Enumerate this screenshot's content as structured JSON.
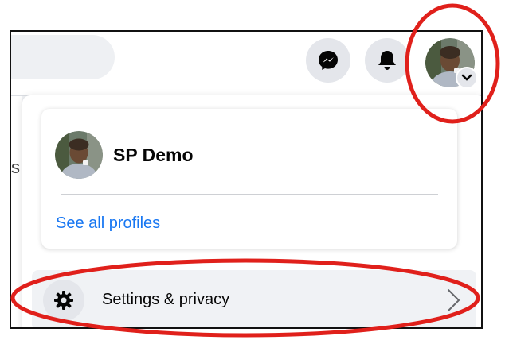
{
  "header": {
    "messenger_icon": "messenger-icon",
    "notifications_icon": "bell-icon",
    "account_icon": "avatar-with-chevron"
  },
  "left_partial_text": "s",
  "profile_menu": {
    "profile_name": "SP Demo",
    "see_all_profiles": "See all profiles"
  },
  "settings_row": {
    "label": "Settings & privacy",
    "icon": "gear-icon",
    "chevron": "chevron-right-icon"
  },
  "colors": {
    "link": "#1877f2",
    "annotation": "#e0201b",
    "button_bg": "#e4e6eb"
  }
}
